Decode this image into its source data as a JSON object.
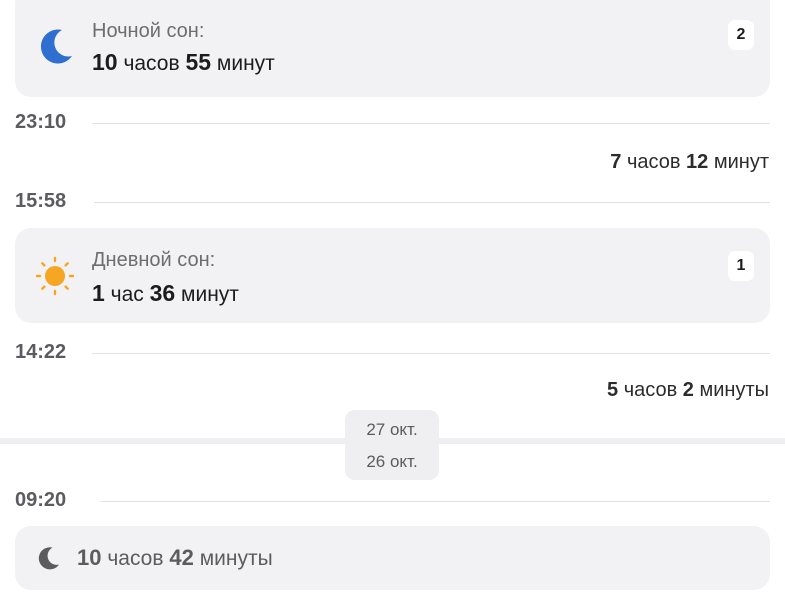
{
  "night_sleep": {
    "title": "Ночной сон:",
    "hours": "10",
    "hours_unit": "часов",
    "minutes": "55",
    "minutes_unit": "минут",
    "badge": "2",
    "icon": "moon-icon",
    "icon_color": "#2f6fd0"
  },
  "times": {
    "t1": "23:10",
    "t2": "15:58",
    "t3": "14:22",
    "t4": "09:20"
  },
  "gap1": {
    "hours": "7",
    "hours_unit": "часов",
    "minutes": "12",
    "minutes_unit": "минут"
  },
  "day_sleep": {
    "title": "Дневной сон:",
    "hours": "1",
    "hours_unit": "час",
    "minutes": "36",
    "minutes_unit": "минут",
    "badge": "1",
    "icon": "sun-icon",
    "icon_color": "#f5a623"
  },
  "gap2": {
    "hours": "5",
    "hours_unit": "часов",
    "minutes": "2",
    "minutes_unit": "минуты"
  },
  "date_separator": {
    "upper": "27 окт.",
    "lower": "26 окт."
  },
  "prev_night": {
    "hours": "10",
    "hours_unit": "часов",
    "minutes": "42",
    "minutes_unit": "минуты",
    "icon": "moon-icon"
  }
}
